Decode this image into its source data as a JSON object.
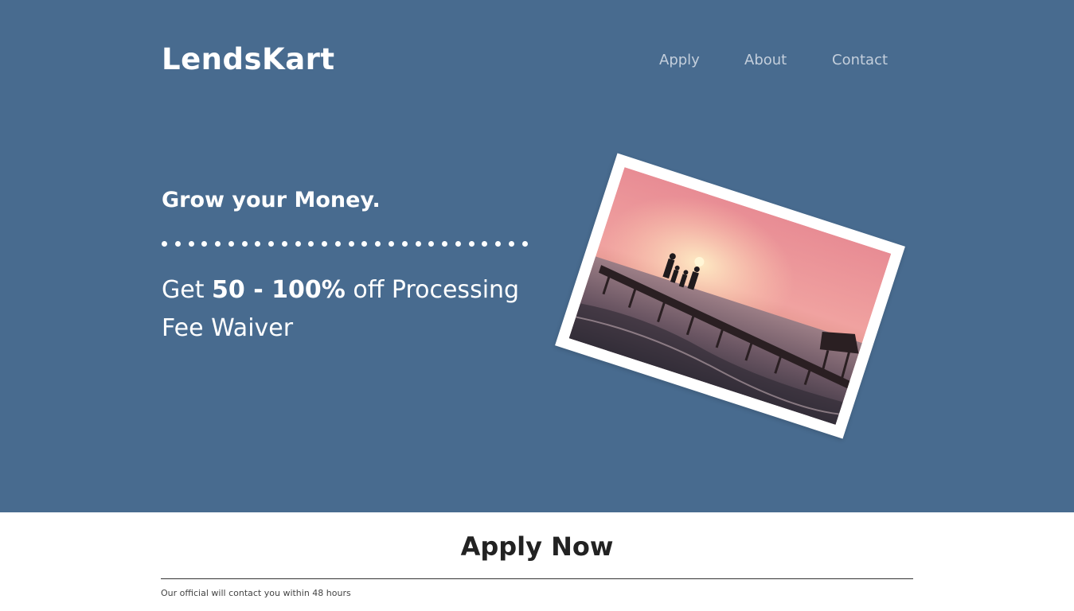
{
  "header": {
    "brand": "LendsKart",
    "nav": [
      {
        "label": "Apply"
      },
      {
        "label": "About"
      },
      {
        "label": "Contact"
      }
    ]
  },
  "hero": {
    "headline": "Grow your Money.",
    "offer_prefix": "Get ",
    "offer_bold": "50 - 100%",
    "offer_suffix": " off Processing Fee Waiver"
  },
  "apply_section": {
    "title": "Apply Now",
    "note": "Our official will contact you within 48 hours"
  },
  "colors": {
    "hero_background": "#486b8f",
    "nav_text": "#c4cfdc",
    "text_light": "#ffffff",
    "text_dark": "#222222"
  }
}
